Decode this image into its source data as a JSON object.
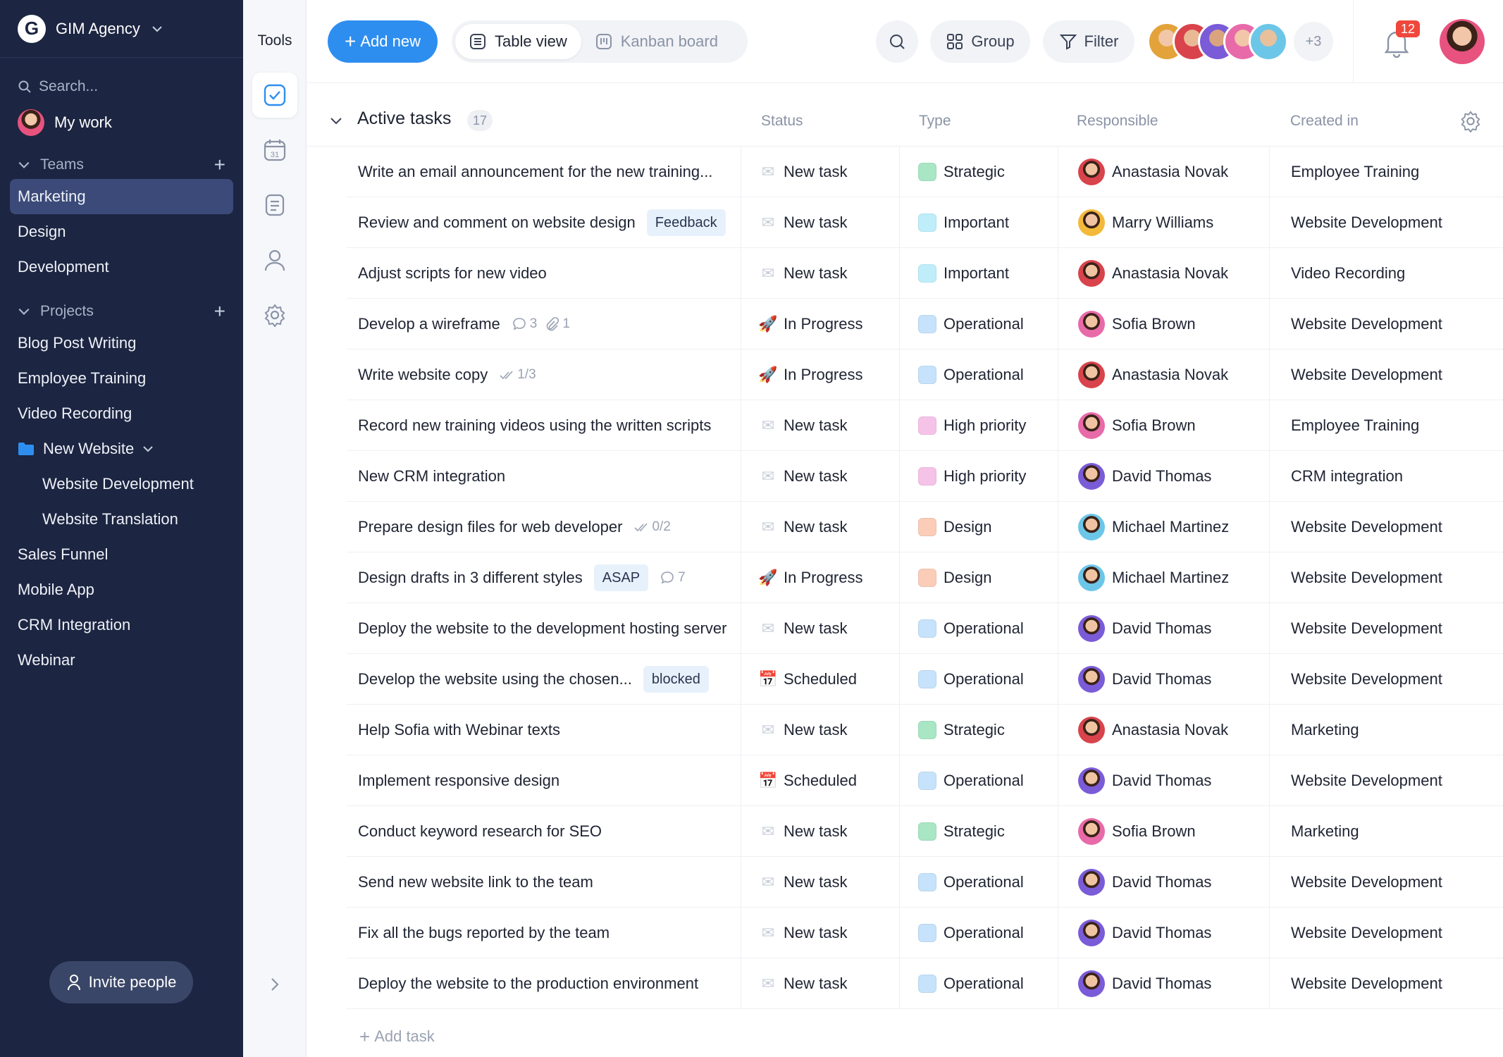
{
  "workspace": {
    "name": "GIM Agency",
    "logo_letter": "G"
  },
  "sidebar": {
    "search_placeholder": "Search...",
    "my_work": "My work",
    "teams_label": "Teams",
    "teams": [
      {
        "label": "Marketing",
        "active": true
      },
      {
        "label": "Design"
      },
      {
        "label": "Development"
      }
    ],
    "projects_label": "Projects",
    "projects": [
      {
        "label": "Blog Post Writing"
      },
      {
        "label": "Employee Training"
      },
      {
        "label": "Video Recording"
      },
      {
        "label": "New Website",
        "folder": true,
        "expanded": true
      },
      {
        "label": "Website Development",
        "sub": true
      },
      {
        "label": "Website Translation",
        "sub": true
      },
      {
        "label": "Sales Funnel"
      },
      {
        "label": "Mobile App"
      },
      {
        "label": "CRM Integration"
      },
      {
        "label": "Webinar"
      }
    ],
    "invite_label": "Invite people"
  },
  "tools": {
    "title": "Tools",
    "items": [
      "tasks-icon",
      "calendar-icon",
      "notes-icon",
      "people-icon",
      "settings-icon"
    ],
    "calendar_day": "31"
  },
  "toolbar": {
    "add_label": "Add new",
    "views": [
      {
        "label": "Table view",
        "active": true
      },
      {
        "label": "Kanban board"
      }
    ],
    "group_label": "Group",
    "filter_label": "Filter",
    "avatars_more": "+3",
    "notifications_count": "12"
  },
  "table": {
    "group_title": "Active tasks",
    "group_count": "17",
    "columns": {
      "status": "Status",
      "type": "Type",
      "responsible": "Responsible",
      "project": "Created in"
    },
    "add_task_label": "Add task",
    "rows": [
      {
        "name": "Write an email announcement for the new training...",
        "status": "New task",
        "type": "Strategic",
        "responsible": "Anastasia Novak",
        "project": "Employee Training"
      },
      {
        "name": "Review and comment on website design",
        "tag": "Feedback",
        "status": "New task",
        "type": "Important",
        "responsible": "Marry Williams",
        "project": "Website Development"
      },
      {
        "name": "Adjust scripts for new video",
        "status": "New task",
        "type": "Important",
        "responsible": "Anastasia Novak",
        "project": "Video Recording"
      },
      {
        "name": "Develop a wireframe",
        "comments": "3",
        "attachments": "1",
        "status": "In Progress",
        "type": "Operational",
        "responsible": "Sofia Brown",
        "project": "Website Development"
      },
      {
        "name": "Write website copy",
        "checklist": "1/3",
        "status": "In Progress",
        "type": "Operational",
        "responsible": "Anastasia Novak",
        "project": "Website Development"
      },
      {
        "name": "Record new training videos using the written scripts",
        "status": "New task",
        "type": "High priority",
        "responsible": "Sofia Brown",
        "project": "Employee Training"
      },
      {
        "name": "New CRM integration",
        "status": "New task",
        "type": "High priority",
        "responsible": "David Thomas",
        "project": "CRM integration"
      },
      {
        "name": "Prepare design files for web developer",
        "checklist": "0/2",
        "status": "New task",
        "type": "Design",
        "responsible": "Michael Martinez",
        "project": "Website Development"
      },
      {
        "name": "Design drafts in 3 different styles",
        "tag": "ASAP",
        "comments": "7",
        "status": "In Progress",
        "type": "Design",
        "responsible": "Michael Martinez",
        "project": "Website Development"
      },
      {
        "name": "Deploy the website to the development hosting server",
        "status": "New task",
        "type": "Operational",
        "responsible": "David Thomas",
        "project": "Website Development"
      },
      {
        "name": "Develop the website using the chosen...",
        "tag": "blocked",
        "status": "Scheduled",
        "type": "Operational",
        "responsible": "David Thomas",
        "project": "Website Development"
      },
      {
        "name": "Help Sofia with Webinar texts",
        "status": "New task",
        "type": "Strategic",
        "responsible": "Anastasia Novak",
        "project": "Marketing"
      },
      {
        "name": "Implement responsive design",
        "status": "Scheduled",
        "type": "Operational",
        "responsible": "David Thomas",
        "project": "Website Development"
      },
      {
        "name": "Conduct keyword research for SEO",
        "status": "New task",
        "type": "Strategic",
        "responsible": "Sofia Brown",
        "project": "Marketing"
      },
      {
        "name": "Send new website link to the team",
        "status": "New task",
        "type": "Operational",
        "responsible": "David Thomas",
        "project": "Website Development"
      },
      {
        "name": "Fix all the bugs reported by the team",
        "status": "New task",
        "type": "Operational",
        "responsible": "David Thomas",
        "project": "Website Development"
      },
      {
        "name": "Deploy the website to the production environment",
        "status": "New task",
        "type": "Operational",
        "responsible": "David Thomas",
        "project": "Website Development"
      }
    ]
  },
  "colors": {
    "sidebar_bg": "#1c2541",
    "accent": "#2e8ef0",
    "type_colors": {
      "Strategic": "#a8e6c4",
      "Important": "#bfeefa",
      "Operational": "#c6e3fb",
      "High priority": "#f6c3e8",
      "Design": "#fbcdb8"
    },
    "status_icons": {
      "New task": "envelope-icon",
      "In Progress": "rocket-icon",
      "Scheduled": "calendar-icon"
    },
    "people_colors": {
      "Anastasia Novak": "#d9434b",
      "Marry Williams": "#f3b93a",
      "Sofia Brown": "#e86aa8",
      "David Thomas": "#7a5bd8",
      "Michael Martinez": "#6cc6e8"
    }
  }
}
